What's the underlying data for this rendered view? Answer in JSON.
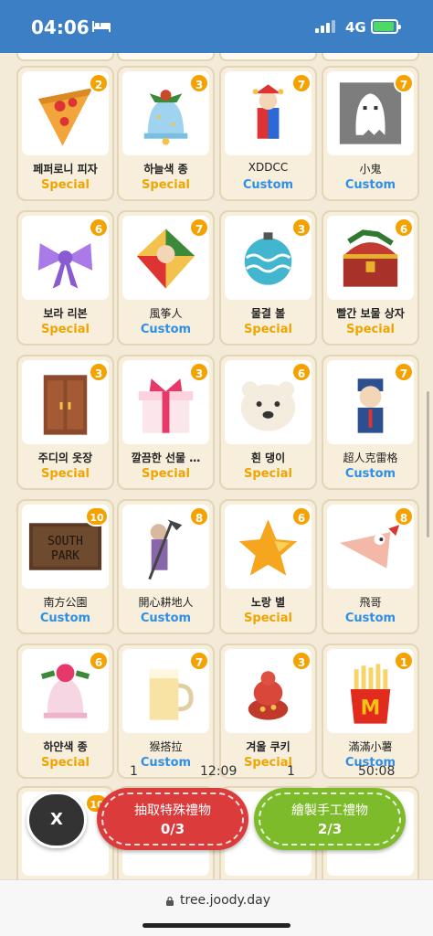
{
  "status": {
    "time": "04:06",
    "network": "4G"
  },
  "colors": {
    "special": "#f0a400",
    "custom": "#2f8fe6",
    "badge": "#f5a200",
    "header": "#3d7fc4"
  },
  "items": [
    {
      "name": "페퍼로니 피자",
      "type": "Special",
      "count": "2",
      "icon": "pizza-icon"
    },
    {
      "name": "하늘색 종",
      "type": "Special",
      "count": "3",
      "icon": "blue-bell-icon"
    },
    {
      "name": "XDDCC",
      "type": "Custom",
      "count": "7",
      "icon": "jester-icon"
    },
    {
      "name": "小鬼",
      "type": "Custom",
      "count": "7",
      "icon": "ghost-icon"
    },
    {
      "name": "보라 리본",
      "type": "Special",
      "count": "6",
      "icon": "purple-ribbon-icon"
    },
    {
      "name": "風筝人",
      "type": "Custom",
      "count": "7",
      "icon": "kite-man-icon"
    },
    {
      "name": "물결 볼",
      "type": "Special",
      "count": "3",
      "icon": "wave-ornament-icon"
    },
    {
      "name": "빨간 보물 상자",
      "type": "Special",
      "count": "6",
      "icon": "treasure-chest-icon"
    },
    {
      "name": "주디의 옷장",
      "type": "Special",
      "count": "3",
      "icon": "wardrobe-icon"
    },
    {
      "name": "깔끔한 선물 …",
      "type": "Special",
      "count": "3",
      "icon": "gift-box-icon"
    },
    {
      "name": "흰 댕이",
      "type": "Special",
      "count": "6",
      "icon": "white-bear-icon"
    },
    {
      "name": "超人克雷格",
      "type": "Custom",
      "count": "7",
      "icon": "craig-icon"
    },
    {
      "name": "南方公園",
      "type": "Custom",
      "count": "10",
      "icon": "south-park-sign-icon"
    },
    {
      "name": "開心耕地人",
      "type": "Custom",
      "count": "8",
      "icon": "farmer-icon"
    },
    {
      "name": "노랑 별",
      "type": "Special",
      "count": "6",
      "icon": "yellow-star-icon"
    },
    {
      "name": "飛哥",
      "type": "Custom",
      "count": "8",
      "icon": "phineas-icon"
    },
    {
      "name": "하얀색 종",
      "type": "Special",
      "count": "6",
      "icon": "white-bell-icon"
    },
    {
      "name": "猴搭拉",
      "type": "Custom",
      "count": "7",
      "icon": "beer-mug-icon"
    },
    {
      "name": "겨울 쿠키",
      "type": "Special",
      "count": "3",
      "icon": "winter-cookie-icon"
    },
    {
      "name": "滿滿小薯",
      "type": "Custom",
      "count": "1",
      "icon": "fries-icon"
    }
  ],
  "partial_row_badge": "10",
  "overlay": {
    "left_a": "1",
    "left_time": "12:09",
    "right_a": "1",
    "right_time": "50:08"
  },
  "actions": {
    "close_label": "X",
    "draw_special_label": "抽取特殊禮物",
    "draw_special_count": "0/3",
    "draw_custom_label": "繪製手工禮物",
    "draw_custom_count": "2/3"
  },
  "browser": {
    "url": "tree.joody.day"
  }
}
